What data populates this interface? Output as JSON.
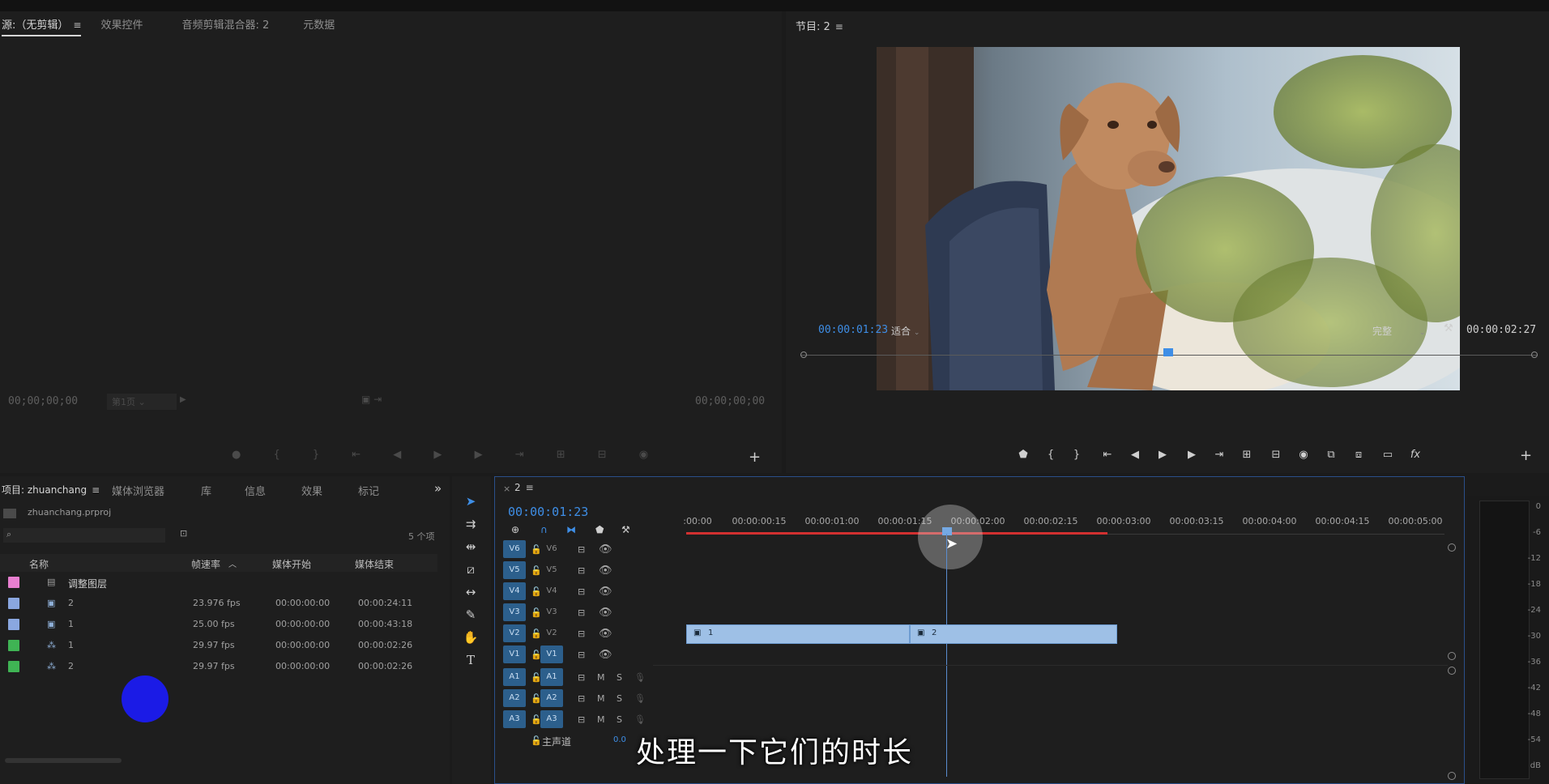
{
  "source_panel": {
    "tabs": [
      "源:（无剪辑）",
      "效果控件",
      "音频剪辑混合器: 2",
      "元数据"
    ],
    "timecode_left": "00;00;00;00",
    "page_select": "第1页",
    "timecode_right": "00;00;00;00"
  },
  "program_panel": {
    "title": "节目: 2",
    "timecode_current": "00:00:01:23",
    "fit_select": "适合",
    "quality_select": "完整",
    "timecode_duration": "00:00:02:27",
    "fx_label": "fx"
  },
  "project_panel": {
    "tabs": [
      "项目: zhuanchang",
      "媒体浏览器",
      "库",
      "信息",
      "效果",
      "标记"
    ],
    "project_file": "zhuanchang.prproj",
    "item_count": "5 个项",
    "columns": [
      "名称",
      "帧速率",
      "媒体开始",
      "媒体结束"
    ],
    "rows": [
      {
        "color": "#e87fd0",
        "name": "调整图层",
        "fps": "",
        "start": "",
        "end": ""
      },
      {
        "color": "#8aa7e0",
        "name": "2",
        "fps": "23.976 fps",
        "start": "00:00:00:00",
        "end": "00:00:24:11"
      },
      {
        "color": "#8aa7e0",
        "name": "1",
        "fps": "25.00 fps",
        "start": "00:00:00:00",
        "end": "00:00:43:18"
      },
      {
        "color": "#3fb454",
        "name": "1",
        "fps": "29.97 fps",
        "start": "00:00:00:00",
        "end": "00:00:02:26"
      },
      {
        "color": "#3fb454",
        "name": "2",
        "fps": "29.97 fps",
        "start": "00:00:00:00",
        "end": "00:00:02:26"
      }
    ]
  },
  "timeline": {
    "sequence_tab": "2",
    "timecode": "00:00:01:23",
    "ruler_labels": [
      ":00:00",
      "00:00:00:15",
      "00:00:01:00",
      "00:00:01:15",
      "00:00:02:00",
      "00:00:02:15",
      "00:00:03:00",
      "00:00:03:15",
      "00:00:04:00",
      "00:00:04:15",
      "00:00:05:00"
    ],
    "video_tracks": [
      {
        "id": "V6",
        "label": "V6",
        "target": false
      },
      {
        "id": "V5",
        "label": "V5",
        "target": false
      },
      {
        "id": "V4",
        "label": "V4",
        "target": false
      },
      {
        "id": "V3",
        "label": "V3",
        "target": false
      },
      {
        "id": "V2",
        "label": "V2",
        "target": false
      },
      {
        "id": "V1",
        "label": "V1",
        "target": true
      }
    ],
    "audio_tracks": [
      {
        "id": "A1",
        "label": "A1",
        "m": "M",
        "s": "S"
      },
      {
        "id": "A2",
        "label": "A2",
        "m": "M",
        "s": "S"
      },
      {
        "id": "A3",
        "label": "A3",
        "m": "M",
        "s": "S"
      }
    ],
    "master_label": "主声道",
    "master_value": "0.0",
    "clips": [
      {
        "name": "1",
        "track": "V2"
      },
      {
        "name": "2",
        "track": "V2"
      }
    ]
  },
  "vu_meter": {
    "labels": [
      "0",
      "-6",
      "-12",
      "-18",
      "-24",
      "-30",
      "-36",
      "-42",
      "-48",
      "-54",
      "dB"
    ]
  },
  "subtitle": "处理一下它们的时长",
  "colors": {
    "accent_blue": "#3e8ee6",
    "clip_blue": "#9ec0e6",
    "work_area_red": "#d23030",
    "cursor_circle": "#1b1be6"
  },
  "icons": {
    "menu": "≡",
    "play": "▶",
    "more": "»",
    "wrench": "🔧",
    "plus": "+"
  }
}
